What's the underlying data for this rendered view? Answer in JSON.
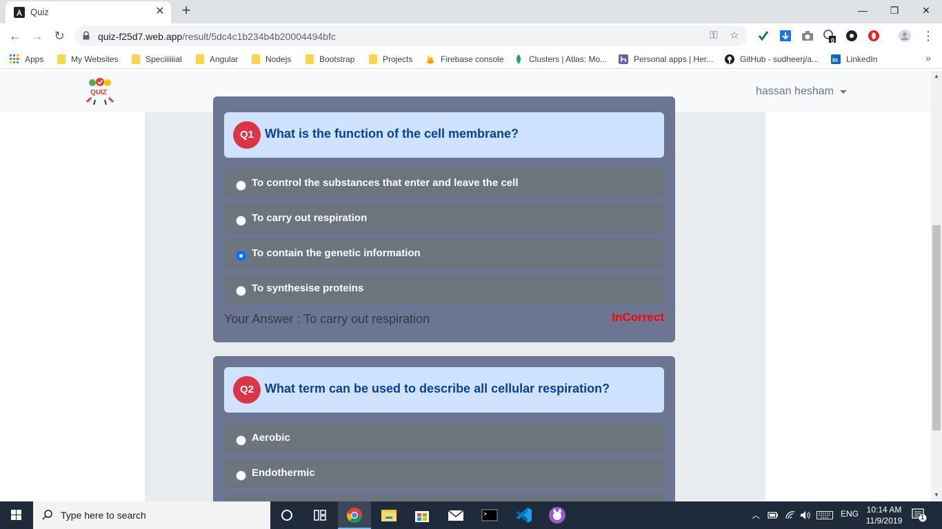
{
  "browser": {
    "tab_title": "Quiz",
    "url_host": "quiz-f25d7.web.app",
    "url_path": "/result/5dc4c1b234b4b20004494bfc",
    "extension_badge": "0",
    "bookmarks": [
      {
        "label": "Apps",
        "icon": "apps-grid-icon"
      },
      {
        "label": "My Websites",
        "icon": "folder-icon"
      },
      {
        "label": "Speciiiiiial",
        "icon": "folder-icon"
      },
      {
        "label": "Angular",
        "icon": "folder-icon"
      },
      {
        "label": "Nodejs",
        "icon": "folder-icon"
      },
      {
        "label": "Bootstrap",
        "icon": "folder-icon"
      },
      {
        "label": "Projects",
        "icon": "folder-icon"
      },
      {
        "label": "Firebase console",
        "icon": "firebase-icon"
      },
      {
        "label": "Clusters | Atlas: Mo...",
        "icon": "mongodb-leaf-icon"
      },
      {
        "label": "Personal apps | Her...",
        "icon": "heroku-icon"
      },
      {
        "label": "GitHub - sudheerj/a...",
        "icon": "github-icon"
      },
      {
        "label": "LinkedIn",
        "icon": "linkedin-icon"
      }
    ],
    "more_bookmarks": "»"
  },
  "app": {
    "logo_text": "QUIZ",
    "user_name": "hassan hesham"
  },
  "questions": [
    {
      "badge": "Q1",
      "text": "What is the function of the cell membrane?",
      "options": [
        {
          "label": "To control the substances that enter and leave the cell",
          "checked": false
        },
        {
          "label": "To carry out respiration",
          "checked": false
        },
        {
          "label": "To contain the genetic information",
          "checked": true
        },
        {
          "label": "To synthesise proteins",
          "checked": false
        }
      ],
      "your_answer": "Your Answer : To carry out respiration",
      "result": "InCorrect"
    },
    {
      "badge": "Q2",
      "text": "What term can be used to describe all cellular respiration?",
      "options": [
        {
          "label": "Aerobic",
          "checked": false
        },
        {
          "label": "Endothermic",
          "checked": false
        }
      ]
    }
  ],
  "taskbar": {
    "search_placeholder": "Type here to search",
    "language": "ENG",
    "time": "10:14 AM",
    "date": "11/9/2019",
    "notification_count": "1"
  },
  "colors": {
    "card_bg": "#6c7591",
    "option_bg": "#6c757d",
    "question_head_bg": "#cfe2ff",
    "badge_red": "#dc3545",
    "incorrect_red": "#ff0000"
  }
}
